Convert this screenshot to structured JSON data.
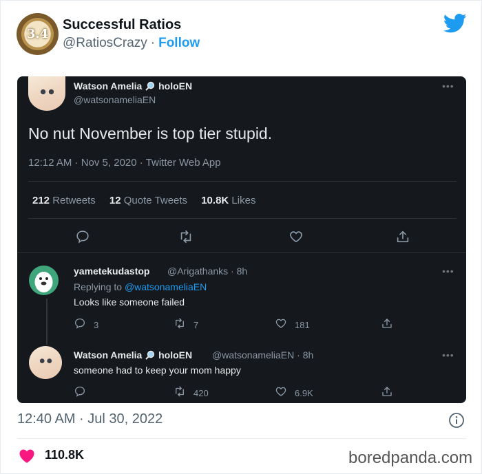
{
  "embed": {
    "author_name": "Successful Ratios",
    "author_handle": "@RatiosCrazy",
    "separator": "·",
    "follow_label": "Follow",
    "avatar_text": "3.4",
    "timestamp": "12:40 AM · Jul 30, 2022",
    "likes": "110.8K",
    "watermark": "boredpanda.com",
    "colors": {
      "accent": "#1d9bf0",
      "heart": "#f91880",
      "dark_bg": "#15181d"
    }
  },
  "screenshot": {
    "main_tweet": {
      "name": "Watson Amelia",
      "name_suffix": "holoEN",
      "handle": "@watsonameliaEN",
      "text": "No nut November is top tier stupid.",
      "meta": "12:12 AM · Nov 5, 2020 · Twitter Web App",
      "stats": [
        {
          "num": "212",
          "label": "Retweets"
        },
        {
          "num": "12",
          "label": "Quote Tweets"
        },
        {
          "num": "10.8K",
          "label": "Likes"
        }
      ],
      "more": "•••"
    },
    "reply1": {
      "name": "yametekudastop",
      "handle_time": "@Arigathanks · 8h",
      "replying_prefix": "Replying to",
      "replying_handle": "@watsonameliaEN",
      "text": "Looks like someone failed",
      "replies": "3",
      "retweets": "7",
      "likes": "181",
      "more": "•••"
    },
    "reply2": {
      "name": "Watson Amelia",
      "name_suffix": "holoEN",
      "handle_time": "@watsonameliaEN · 8h",
      "text": "someone had to keep your mom happy",
      "retweets": "420",
      "likes": "6.9K",
      "more": "•••"
    }
  }
}
